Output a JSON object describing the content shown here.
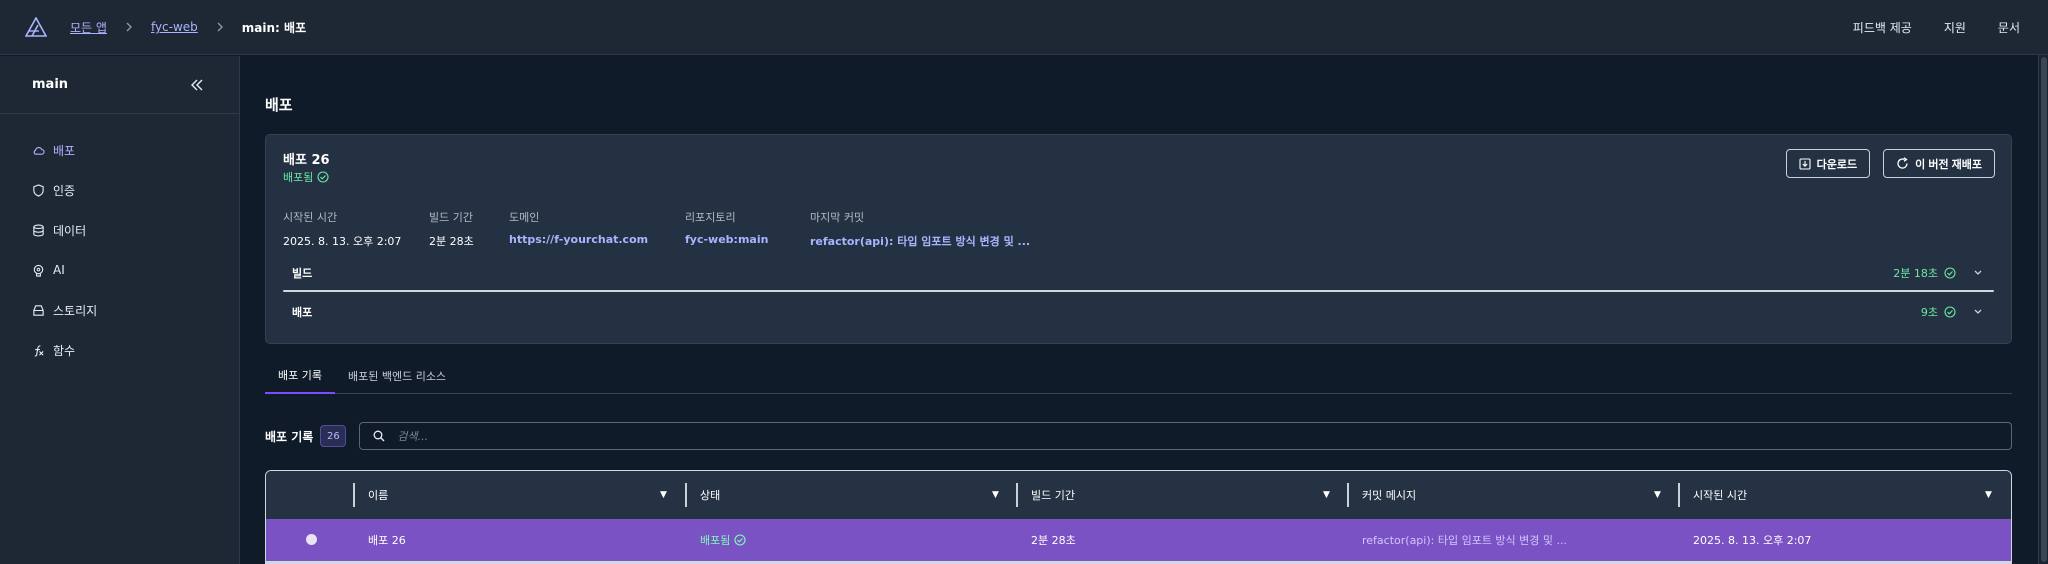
{
  "breadcrumbs": {
    "all_apps": "모든 앱",
    "app": "fyc-web",
    "current": "main: 배포"
  },
  "topnav": {
    "feedback": "피드백 제공",
    "support": "지원",
    "docs": "문서"
  },
  "sidebar": {
    "title": "main",
    "items": [
      {
        "label": "배포",
        "icon": "cloud-icon",
        "active": true
      },
      {
        "label": "인증",
        "icon": "shield-icon"
      },
      {
        "label": "데이터",
        "icon": "database-icon"
      },
      {
        "label": "AI",
        "icon": "brain-icon"
      },
      {
        "label": "스토리지",
        "icon": "storage-icon"
      },
      {
        "label": "함수",
        "icon": "function-icon"
      }
    ]
  },
  "page": {
    "title": "배포"
  },
  "deployment": {
    "title": "배포 26",
    "status": "배포됨",
    "download_label": "다운로드",
    "redeploy_label": "이 버전 재배포",
    "meta": {
      "started_label": "시작된 시간",
      "started_value": "2025. 8. 13. 오후 2:07",
      "build_time_label": "빌드 기간",
      "build_time_value": "2분 28초",
      "domain_label": "도메인",
      "domain_value": "https://f-yourchat.com",
      "repo_label": "리포지토리",
      "repo_value": "fyc-web:main",
      "commit_label": "마지막 커밋",
      "commit_value": "refactor(api): 타입 임포트 방식 변경 및 ..."
    },
    "steps": [
      {
        "label": "빌드",
        "duration": "2분 18초"
      },
      {
        "label": "배포",
        "duration": "9초"
      }
    ]
  },
  "tabs": [
    {
      "label": "배포 기록",
      "active": true
    },
    {
      "label": "배포된 백엔드 리소스",
      "active": false
    }
  ],
  "history": {
    "label": "배포 기록",
    "count": "26",
    "search_placeholder": "검색..."
  },
  "table": {
    "columns": [
      "이름",
      "상태",
      "빌드 기간",
      "커밋 메시지",
      "시작된 시간"
    ],
    "rows": [
      {
        "name": "배포 26",
        "status": "배포됨",
        "build_time": "2분 28초",
        "commit": "refactor(api): 타입 임포트 방식 변경 및 ...",
        "started": "2025. 8. 13. 오후 2:07",
        "selected": true
      }
    ]
  },
  "colors": {
    "accent": "#7c4dff",
    "success": "#6ee7a3",
    "selected_row": "#7a52c4",
    "link": "#a9b4ff"
  }
}
